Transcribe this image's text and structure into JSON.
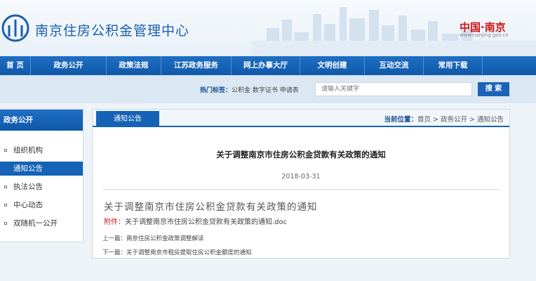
{
  "header": {
    "site_name": "南京住房公积金管理中心",
    "city_brand": "中国·南京",
    "city_url": "www.nanjing.gov.cn"
  },
  "nav": {
    "items": [
      {
        "label": "首 页"
      },
      {
        "label": "政务公开"
      },
      {
        "label": "政策法规"
      },
      {
        "label": "江苏政务服务"
      },
      {
        "label": "网上办事大厅"
      },
      {
        "label": "文明创建"
      },
      {
        "label": "互动交流"
      },
      {
        "label": "常用下载"
      }
    ]
  },
  "search": {
    "hot_label": "热门标签：",
    "hot_tags": "公积金 数字证书 申请表",
    "placeholder": "请输入关键字",
    "button_label": "搜 索"
  },
  "sidebar": {
    "title": "政务公开",
    "items": [
      {
        "label": "组织机构"
      },
      {
        "label": "通知公告"
      },
      {
        "label": "执法公告"
      },
      {
        "label": "中心动态"
      },
      {
        "label": "双随机一公开"
      }
    ],
    "active_index": 1
  },
  "main": {
    "tab_label": "通知公告",
    "breadcrumb_label": "当前位置：",
    "breadcrumb_path": "首页 > 政务公开 > 通知公告",
    "article_title": "关于调整南京市住房公积金贷款有关政策的通知",
    "article_date": "2018-03-31",
    "body_title": "关于调整南京市住房公积金贷款有关政策的通知",
    "attachment_label": "附件：",
    "attachment_file": "关于调整南京市住房公积金贷款有关政策的通知.doc",
    "prev_label": "上一篇：",
    "prev_title": "南京住房公积金政策调整解读",
    "next_label": "下一篇：",
    "next_title": "关于调整南京市租房提取住房公积金额度的通知"
  },
  "colors": {
    "primary": "#1563b6",
    "nav_top": "#1f6fc4",
    "accent_red": "#d01818",
    "page_bg": "#eef3f8"
  }
}
